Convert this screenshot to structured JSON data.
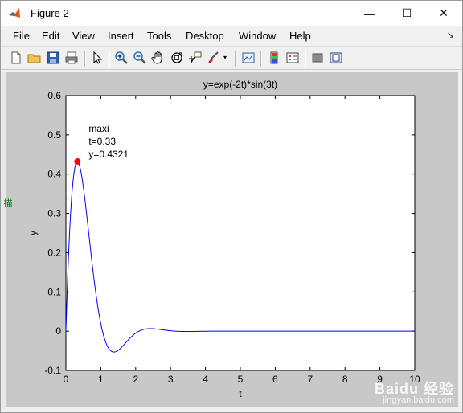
{
  "window": {
    "title": "Figure 2",
    "controls": {
      "minimize": "—",
      "maximize": "☐",
      "close": "✕"
    }
  },
  "menu": [
    {
      "label": "File"
    },
    {
      "label": "Edit"
    },
    {
      "label": "View"
    },
    {
      "label": "Insert"
    },
    {
      "label": "Tools"
    },
    {
      "label": "Desktop"
    },
    {
      "label": "Window"
    },
    {
      "label": "Help"
    }
  ],
  "toolbar": [
    "new-file-icon",
    "open-folder-icon",
    "save-icon",
    "print-icon",
    "pointer-icon",
    "zoom-in-icon",
    "zoom-out-icon",
    "pan-hand-icon",
    "rotate-3d-icon",
    "data-cursor-icon",
    "brush-icon",
    "link-plot-icon",
    "colorbar-icon",
    "legend-icon",
    "hide-plot-tools-icon",
    "show-plot-tools-icon"
  ],
  "side_mark": "描",
  "watermark": {
    "brand": "Baidu 经验",
    "url": "jingyan.baidu.com"
  },
  "colors": {
    "curve": "#0000ff",
    "marker": "#ff0000",
    "figure_bg": "#c8c8c8"
  },
  "chart_data": {
    "type": "line",
    "title": "y=exp(-2t)*sin(3t)",
    "xlabel": "t",
    "ylabel": "y",
    "xlim": [
      0,
      10
    ],
    "ylim": [
      -0.1,
      0.6
    ],
    "xticks": [
      0,
      1,
      2,
      3,
      4,
      5,
      6,
      7,
      8,
      9,
      10
    ],
    "yticks": [
      -0.1,
      0,
      0.1,
      0.2,
      0.3,
      0.4,
      0.5,
      0.6
    ],
    "series": [
      {
        "function": "exp(-2t)*sin(3t)",
        "t_range": [
          0,
          10
        ],
        "color": "#0000ff"
      }
    ],
    "marker_point": {
      "x": 0.33,
      "y": 0.4321,
      "color": "#ff0000"
    },
    "annotation": [
      "maxi",
      "t=0.33",
      "y=0.4321"
    ]
  }
}
